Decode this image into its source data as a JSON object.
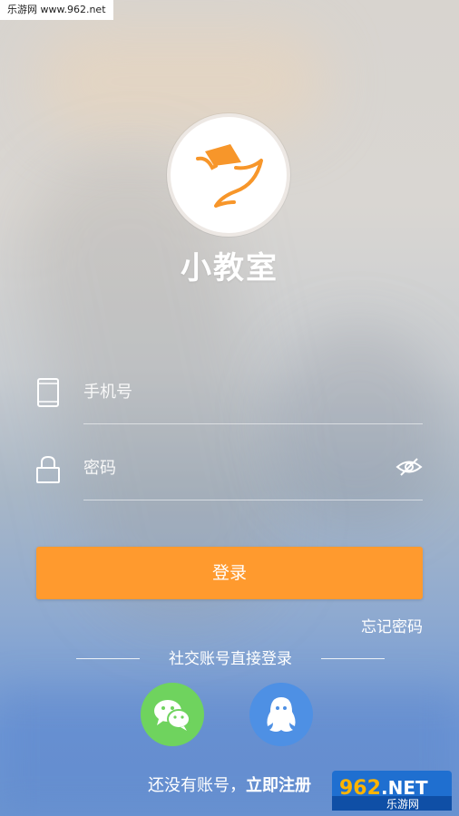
{
  "watermark_top": "乐游网 www.962.net",
  "app": {
    "name": "小教室",
    "logo_icon": "bird-book-logo-icon"
  },
  "phone_field": {
    "placeholder": "手机号",
    "icon": "phone-icon"
  },
  "password_field": {
    "placeholder": "密码",
    "icon": "lock-icon",
    "toggle_icon": "eye-icon"
  },
  "login_button": {
    "label": "登录",
    "color": "#ff9a2e"
  },
  "forgot_password": "忘记密码",
  "social_divider": "社交账号直接登录",
  "social": [
    {
      "name": "wechat",
      "icon": "wechat-icon",
      "color": "#6fd35e"
    },
    {
      "name": "qq",
      "icon": "qq-icon",
      "color": "#4e90e4"
    }
  ],
  "register": {
    "prompt": "还没有账号，",
    "link": "立即注册"
  },
  "corner_watermark": {
    "brand": "962",
    "suffix": ".NET",
    "sub": "乐游网"
  }
}
